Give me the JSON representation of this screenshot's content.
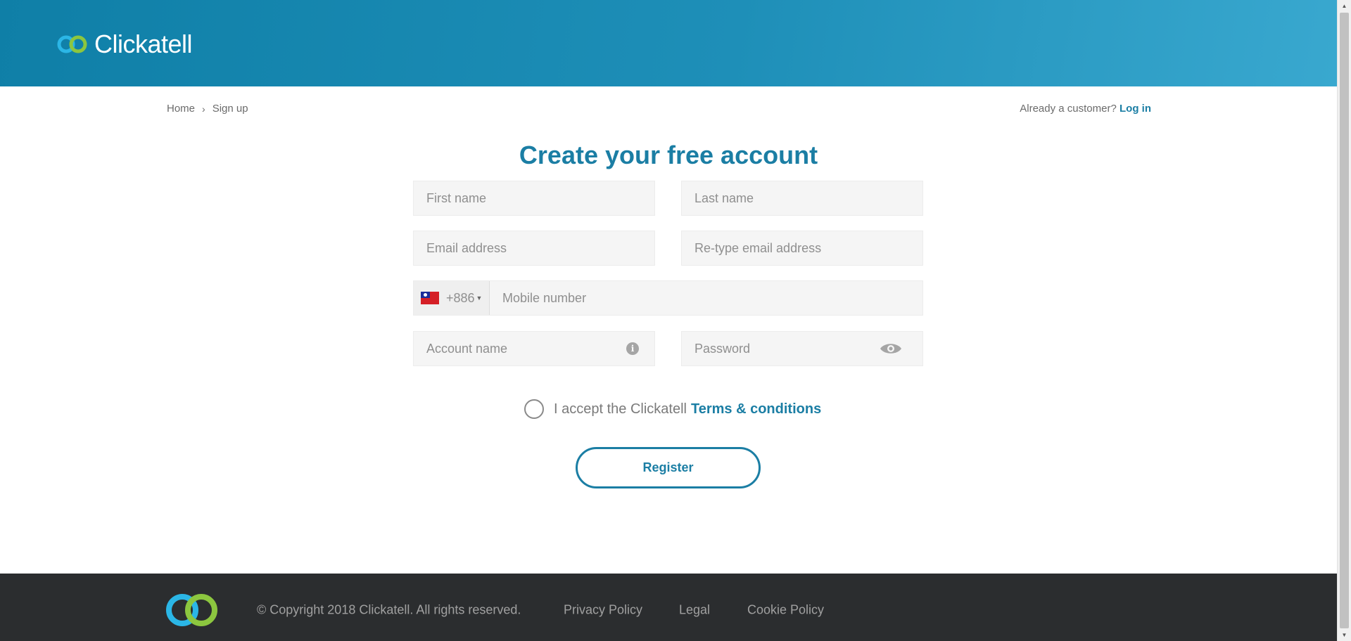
{
  "brand": {
    "name": "Clickatell",
    "accent": "#1b7ea4",
    "logo_blue": "#2bb6e6",
    "logo_green": "#8cc63f"
  },
  "breadcrumb": {
    "home": "Home",
    "separator": "›",
    "current": "Sign up"
  },
  "login": {
    "prompt": "Already a customer?",
    "link": "Log in"
  },
  "form": {
    "title": "Create your free account",
    "first_name_placeholder": "First name",
    "last_name_placeholder": "Last name",
    "email_placeholder": "Email address",
    "retype_email_placeholder": "Re-type email address",
    "country_code": "+886",
    "mobile_placeholder": "Mobile number",
    "account_name_placeholder": "Account name",
    "password_placeholder": "Password",
    "info_icon_glyph": "i",
    "terms_prefix": "I accept the Clickatell",
    "terms_link": "Terms & conditions",
    "register_label": "Register"
  },
  "footer": {
    "copyright": "© Copyright 2018 Clickatell. All rights reserved.",
    "links": [
      "Privacy Policy",
      "Legal",
      "Cookie Policy"
    ]
  }
}
